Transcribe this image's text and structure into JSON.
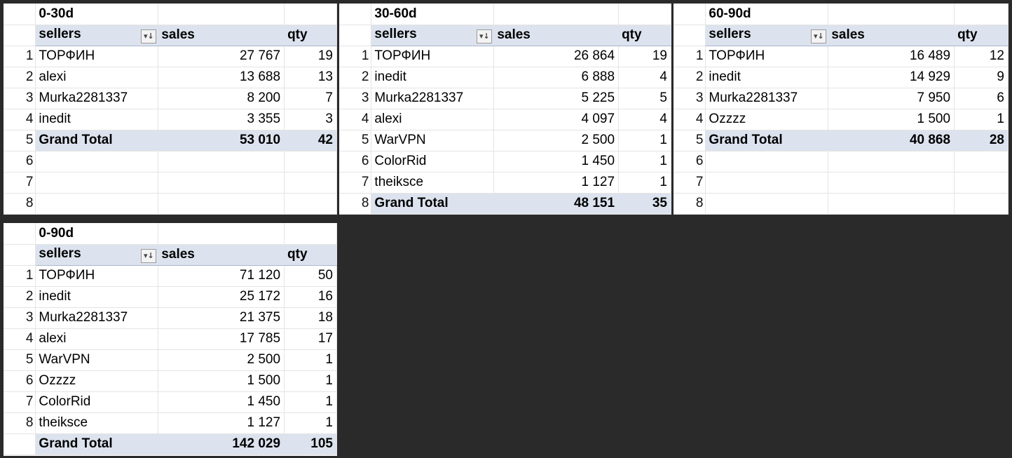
{
  "pivots": [
    {
      "title": "0-30d",
      "headers": {
        "sellers": "sellers",
        "sales": "sales",
        "qty": "qty"
      },
      "rows": [
        {
          "n": "1",
          "seller": "ТОРФИН",
          "sales": "27 767",
          "qty": "19"
        },
        {
          "n": "2",
          "seller": "alexi",
          "sales": "13 688",
          "qty": "13"
        },
        {
          "n": "3",
          "seller": "Murka2281337",
          "sales": "8 200",
          "qty": "7"
        },
        {
          "n": "4",
          "seller": "inedit",
          "sales": "3 355",
          "qty": "3"
        }
      ],
      "total": {
        "n": "5",
        "label": "Grand Total",
        "sales": "53 010",
        "qty": "42"
      },
      "empty_rows": [
        "6",
        "7",
        "8"
      ]
    },
    {
      "title": "30-60d",
      "headers": {
        "sellers": "sellers",
        "sales": "sales",
        "qty": "qty"
      },
      "rows": [
        {
          "n": "1",
          "seller": "ТОРФИН",
          "sales": "26 864",
          "qty": "19"
        },
        {
          "n": "2",
          "seller": "inedit",
          "sales": "6 888",
          "qty": "4"
        },
        {
          "n": "3",
          "seller": "Murka2281337",
          "sales": "5 225",
          "qty": "5"
        },
        {
          "n": "4",
          "seller": "alexi",
          "sales": "4 097",
          "qty": "4"
        },
        {
          "n": "5",
          "seller": "WarVPN",
          "sales": "2 500",
          "qty": "1"
        },
        {
          "n": "6",
          "seller": "ColorRid",
          "sales": "1 450",
          "qty": "1"
        },
        {
          "n": "7",
          "seller": "theiksce",
          "sales": "1 127",
          "qty": "1"
        }
      ],
      "total": {
        "n": "8",
        "label": "Grand Total",
        "sales": "48 151",
        "qty": "35"
      },
      "empty_rows": []
    },
    {
      "title": "60-90d",
      "headers": {
        "sellers": "sellers",
        "sales": "sales",
        "qty": "qty"
      },
      "rows": [
        {
          "n": "1",
          "seller": "ТОРФИН",
          "sales": "16 489",
          "qty": "12"
        },
        {
          "n": "2",
          "seller": "inedit",
          "sales": "14 929",
          "qty": "9"
        },
        {
          "n": "3",
          "seller": "Murka2281337",
          "sales": "7 950",
          "qty": "6"
        },
        {
          "n": "4",
          "seller": "Ozzzz",
          "sales": "1 500",
          "qty": "1"
        }
      ],
      "total": {
        "n": "5",
        "label": "Grand Total",
        "sales": "40 868",
        "qty": "28"
      },
      "empty_rows": [
        "6",
        "7",
        "8"
      ]
    },
    {
      "title": "0-90d",
      "headers": {
        "sellers": "sellers",
        "sales": "sales",
        "qty": "qty"
      },
      "rows": [
        {
          "n": "1",
          "seller": "ТОРФИН",
          "sales": "71 120",
          "qty": "50"
        },
        {
          "n": "2",
          "seller": "inedit",
          "sales": "25 172",
          "qty": "16"
        },
        {
          "n": "3",
          "seller": "Murka2281337",
          "sales": "21 375",
          "qty": "18"
        },
        {
          "n": "4",
          "seller": "alexi",
          "sales": "17 785",
          "qty": "17"
        },
        {
          "n": "5",
          "seller": "WarVPN",
          "sales": "2 500",
          "qty": "1"
        },
        {
          "n": "6",
          "seller": "Ozzzz",
          "sales": "1 500",
          "qty": "1"
        },
        {
          "n": "7",
          "seller": "ColorRid",
          "sales": "1 450",
          "qty": "1"
        },
        {
          "n": "8",
          "seller": "theiksce",
          "sales": "1 127",
          "qty": "1"
        }
      ],
      "total": {
        "n": "",
        "label": "Grand Total",
        "sales": "142 029",
        "qty": "105"
      },
      "empty_rows": []
    }
  ],
  "filter_icon": "sort-filter-icon",
  "colors": {
    "header_bg": "#dce3ee",
    "background": "#2a2a2a",
    "sheet": "#ffffff"
  }
}
